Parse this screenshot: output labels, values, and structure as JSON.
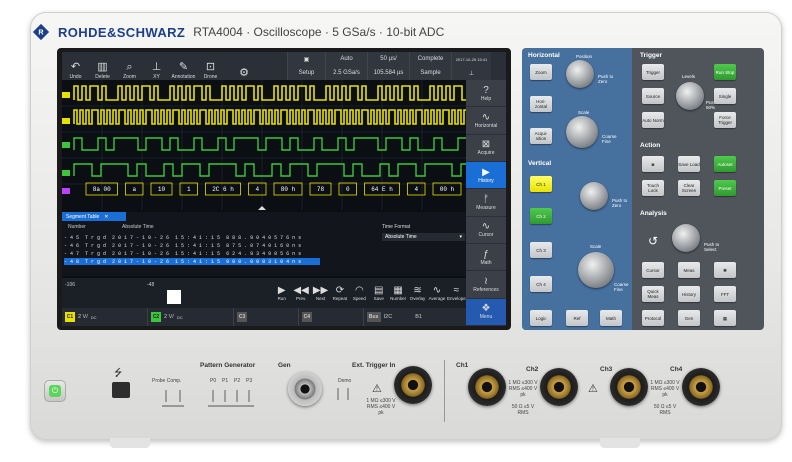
{
  "brand": {
    "name": "ROHDE&SCHWARZ",
    "model": "RTA4004 · Oscilloscope · 5 GSa/s · 10-bit ADC"
  },
  "toolbar": {
    "buttons": [
      {
        "label": "Undo",
        "icon": "undo-icon"
      },
      {
        "label": "Delete",
        "icon": "trash-icon"
      },
      {
        "label": "Zoom",
        "icon": "zoom-icon"
      },
      {
        "label": "XY",
        "icon": "xy-icon"
      },
      {
        "label": "Annotation",
        "icon": "pen-icon"
      },
      {
        "label": "Drone",
        "icon": "drone-icon"
      }
    ]
  },
  "header": {
    "r1": [
      "",
      "Auto",
      "50 µs/",
      "Complete",
      "2017-10-26 15:41"
    ],
    "r2": [
      "Setup",
      "2.5 GSa/s",
      "105.584 µs",
      "Sample",
      ""
    ]
  },
  "sidebar": {
    "items": [
      {
        "label": "Help",
        "icon": "help-icon"
      },
      {
        "label": "Horizontal",
        "icon": "horizontal-icon"
      },
      {
        "label": "Acquire",
        "icon": "acquire-icon"
      },
      {
        "label": "History",
        "icon": "history-icon",
        "active": true
      },
      {
        "label": "Measure",
        "icon": "measure-icon"
      },
      {
        "label": "Cursor",
        "icon": "cursor-icon"
      },
      {
        "label": "Math",
        "icon": "math-icon"
      },
      {
        "label": "References",
        "icon": "references-icon"
      },
      {
        "label": "Menu",
        "icon": "menu-icon"
      }
    ]
  },
  "decode": {
    "bytes": [
      "8a 00",
      "a",
      "10",
      "1",
      "2C 6 h",
      "4",
      "80 h",
      "78",
      "0",
      "64 E h",
      "4",
      "00 h"
    ]
  },
  "segment_table": {
    "tab_label": "Segment Table",
    "headers": {
      "number": "Number",
      "time": "Absolute Time"
    },
    "rows": [
      {
        "n": "- 4 5",
        "trg": "T r g d",
        "date": "2 0 1 7 - 1 0 - 2 6",
        "clock": "1 5 : 4 1 : 1 5",
        "ns": "8 8 8 . 9 0 4 0 5 7  6  n s",
        "sel": false
      },
      {
        "n": "- 4 6",
        "trg": "T r g d",
        "date": "2 0 1 7 - 1 0 - 2 6",
        "clock": "1 5 : 4 1 : 1 5",
        "ns": "8 7 5 . 0 7 4 0 1 6  0  n s",
        "sel": false
      },
      {
        "n": "- 4 7",
        "trg": "T r g d",
        "date": "2 0 1 7 - 1 0 - 2 6",
        "clock": "1 5 : 4 1 : 1 5",
        "ns": "6 2 4 . 9 3 4 9 0 5  6  n s",
        "sel": false
      },
      {
        "n": "- 4 8",
        "trg": "T r g d",
        "date": "2 0 1 7 - 1 0 - 2 6",
        "clock": "1 5 : 4 1 : 1 5",
        "ns": "9 0 0 . 0 0 0 3 1 0  4  n s",
        "sel": true
      }
    ],
    "time_format_label": "Time Format",
    "time_format_value": "Absolute Time"
  },
  "history": {
    "start": "-106",
    "current": "-48",
    "buttons": [
      {
        "label": "Run",
        "icon": "play-icon"
      },
      {
        "label": "Prev.",
        "icon": "prev-icon"
      },
      {
        "label": "Next",
        "icon": "next-icon"
      },
      {
        "label": "Repeat",
        "icon": "repeat-icon"
      },
      {
        "label": "Speed",
        "icon": "speed-icon"
      },
      {
        "label": "Save",
        "icon": "save-icon"
      },
      {
        "label": "Number",
        "icon": "number-icon"
      },
      {
        "label": "Overlay",
        "icon": "overlay-icon"
      },
      {
        "label": "Average",
        "icon": "average-icon"
      },
      {
        "label": "Envelope",
        "icon": "envelope-icon"
      }
    ]
  },
  "channel_bar": {
    "c1": {
      "num": "C1",
      "scale": "2 V/",
      "coupling": "DC",
      "color": "#e8e000"
    },
    "c2": {
      "num": "C2",
      "scale": "2 V/",
      "coupling": "DC",
      "color": "#3cc63c"
    },
    "c3": {
      "num": "C3"
    },
    "c4": {
      "num": "C4"
    },
    "bus": {
      "label": "Bus",
      "value": "I2C",
      "num": "B1"
    }
  },
  "panel": {
    "horizontal": {
      "title": "Horizontal",
      "zoom": "Zoom",
      "horizontal": "Hori- zontal",
      "acquisition": "Acqui- sition",
      "position": "Position",
      "scale": "Scale",
      "push_zero": "Push to Zero",
      "coarse_fine": "Coarse Fine"
    },
    "trigger": {
      "title": "Trigger",
      "trigger": "Trigger",
      "levels": "Levels",
      "source": "Source",
      "auto_norm": "Auto Norm",
      "run_stop": "Run Stop",
      "single": "Single",
      "force_trigger": "Force Trigger",
      "push_50": "Push for 50%"
    },
    "vertical": {
      "title": "Vertical",
      "ch1": "Ch 1",
      "ch2": "Ch 2",
      "ch3": "Ch 3",
      "ch4": "Ch 4",
      "position": "Position",
      "scale": "Scale",
      "push_zero": "Push to Zero",
      "coarse_fine": "Coarse Fine"
    },
    "action": {
      "title": "Action",
      "save_load": "Save Load",
      "autoset": "Autoset",
      "touch_lock": "Touch Lock",
      "clear_screen": "Clear Screen",
      "preset": "Preset"
    },
    "analysis": {
      "title": "Analysis",
      "cursor": "Cursor",
      "meas": "Meas",
      "quick_meas": "Quick Meas",
      "history": "History",
      "fft": "FFT",
      "push_select": "Push to Select"
    },
    "bottom": {
      "logic": "Logic",
      "ref": "Ref",
      "math": "Math",
      "protocol": "Protocol",
      "gen": "Gen"
    }
  },
  "front": {
    "pattern_generator": "Pattern Generator",
    "probe_comp": "Probe Comp.",
    "p_pins": [
      "P0",
      "P1",
      "P2",
      "P3"
    ],
    "gen": "Gen",
    "demo": "Demo",
    "ext_trigger": "Ext. Trigger In",
    "ext_spec": "1 MΩ ≤300 V RMS ≤400 V pk",
    "ch": [
      "Ch1",
      "Ch2",
      "Ch3",
      "Ch4"
    ],
    "spec_a": "1 MΩ ≤300 V RMS ≤400 V pk",
    "spec_b": "50 Ω ≤5 V RMS"
  },
  "colors": {
    "ch1": "#e8e000",
    "ch2": "#3cc63c",
    "bus": "#c040ff",
    "accent": "#1a6fd6"
  }
}
